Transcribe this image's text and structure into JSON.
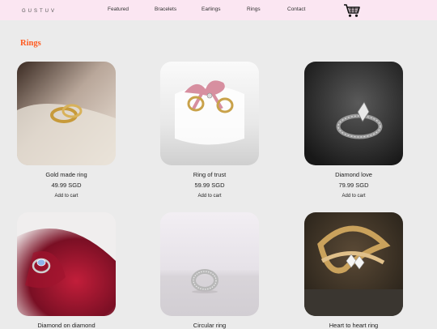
{
  "brand": "GUSTUV",
  "nav": [
    "Featured",
    "Bracelets",
    "Earlings",
    "Rings",
    "Contact"
  ],
  "section_title": "Rings",
  "products": [
    {
      "name": "Gold made ring",
      "price": "49.99 SGD",
      "cta": "Add to cart"
    },
    {
      "name": "Ring of trust",
      "price": "59.99 SGD",
      "cta": "Add to cart"
    },
    {
      "name": "Diamond love",
      "price": "79.99 SGD",
      "cta": "Add to cart"
    },
    {
      "name": "Diamond on diamond"
    },
    {
      "name": "Circular ring"
    },
    {
      "name": "Heart to heart ring"
    }
  ],
  "colors": {
    "nav_bg": "#fbe6f2",
    "accent": "#ff5a1f",
    "page_bg": "#ebebeb"
  }
}
